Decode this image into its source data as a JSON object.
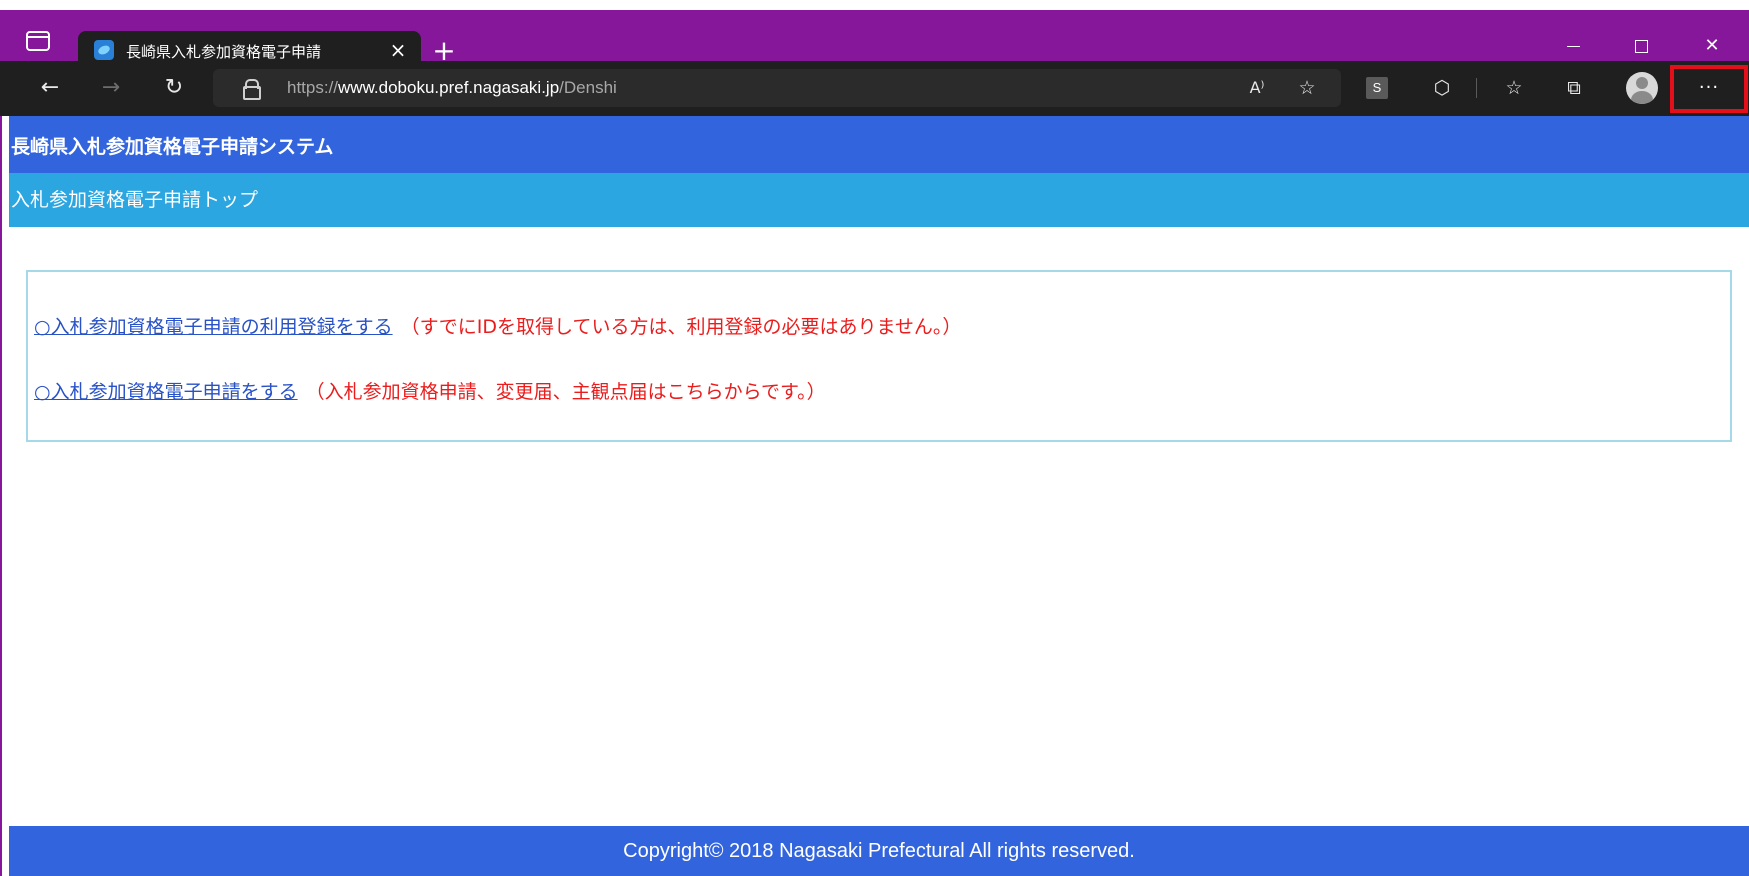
{
  "browser": {
    "tab_title": "長崎県入札参加資格電子申請",
    "tab_close": "×",
    "new_tab": "+",
    "url_scheme": "https://",
    "url_host": "www.doboku.pref.nagasaki.jp",
    "url_path": "/Denshi",
    "extension_badge": "S",
    "more_button": "···",
    "icons": [
      "tab-actions-icon",
      "favicon-icon",
      "back-icon",
      "forward-icon",
      "refresh-icon",
      "lock-icon",
      "read-aloud-icon",
      "add-favorite-icon",
      "extensions-icon",
      "favorites-icon",
      "collections-icon",
      "profile-icon",
      "more-icon"
    ]
  },
  "page": {
    "system_title": "長崎県入札参加資格電子申請システム",
    "sub_title": "入札参加資格電子申請トップ",
    "links": [
      {
        "label": "○入札参加資格電子申請の利用登録をする",
        "note": "（すでにIDを取得している方は、利用登録の必要はありません。）"
      },
      {
        "label": "○入札参加資格電子申請をする",
        "note": "（入札参加資格申請、変更届、主観点届はこちらからです。）"
      }
    ],
    "footer": "Copyright© 2018 Nagasaki Prefectural All rights reserved."
  },
  "colors": {
    "titlebar": "#86169a",
    "header_blue": "#3265dd",
    "subheader_blue": "#2ba6e0",
    "link": "#2852c6",
    "note_red": "#ea1d1d",
    "highlight_red": "#e3101b"
  }
}
